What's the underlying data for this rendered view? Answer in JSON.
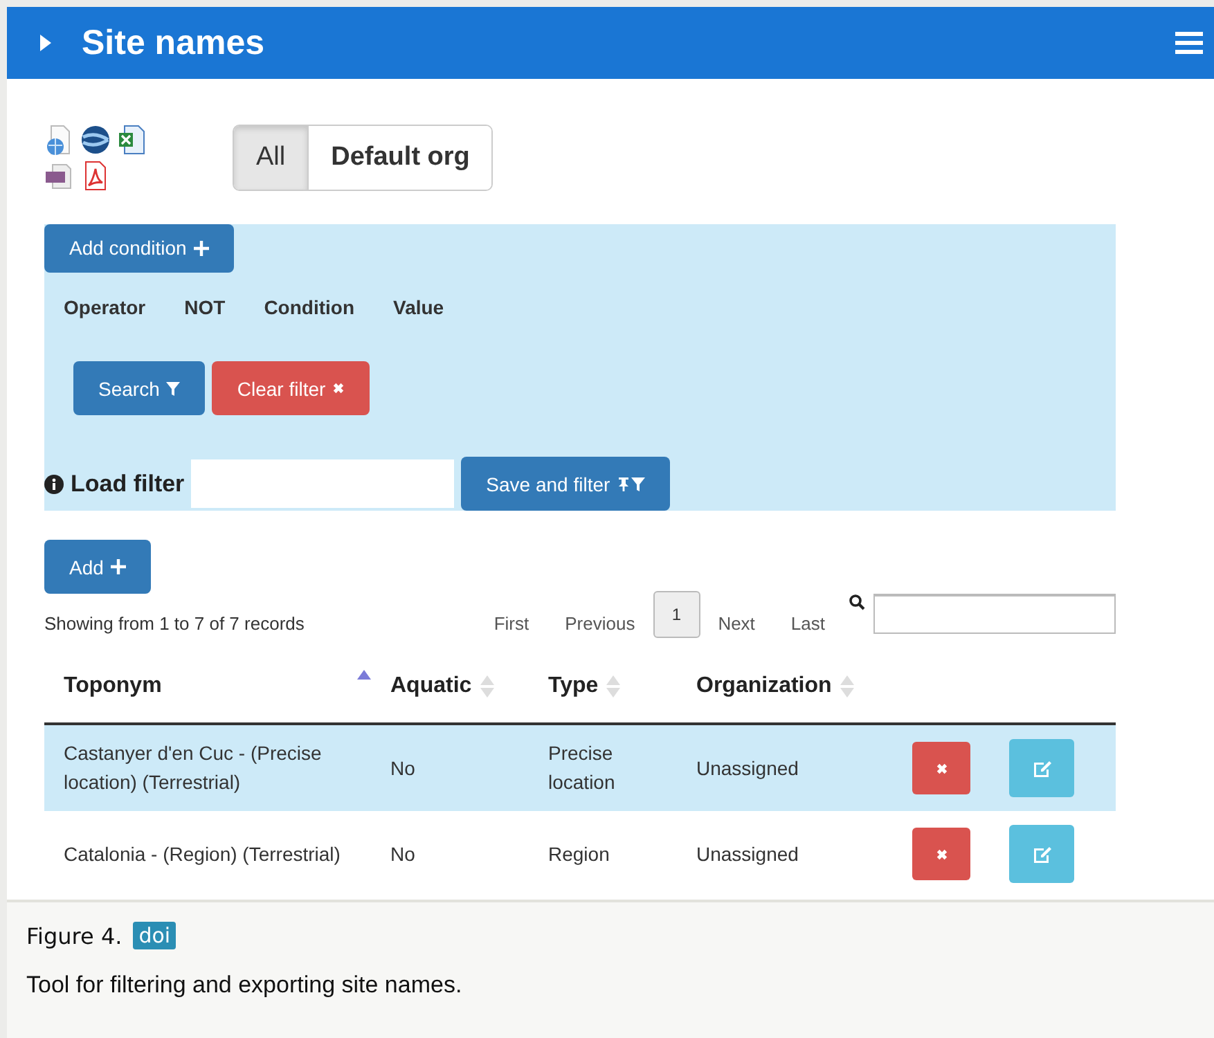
{
  "header": {
    "title": "Site names"
  },
  "exports": [
    {
      "kind": "web"
    },
    {
      "kind": "globe"
    },
    {
      "kind": "excel"
    },
    {
      "kind": "csv"
    },
    {
      "kind": "pdf"
    }
  ],
  "org_toggle": [
    {
      "label": "All",
      "selected": true
    },
    {
      "label": "Default org",
      "selected": false
    }
  ],
  "filter": {
    "add_condition": "Add condition",
    "columns": [
      "Operator",
      "NOT",
      "Condition",
      "Value"
    ],
    "search_button": "Search",
    "clear_button": "Clear filter",
    "load_filter_label": "Load filter",
    "save_button": "Save and filter"
  },
  "add_button": "Add",
  "records_info": "Showing from 1 to 7 of 7 records",
  "pagination": [
    {
      "label": "First",
      "kind": "link"
    },
    {
      "label": "Previous",
      "kind": "link"
    },
    {
      "label": "1",
      "kind": "page",
      "selected": true
    },
    {
      "label": "Next",
      "kind": "link"
    },
    {
      "label": "Last",
      "kind": "link"
    }
  ],
  "table": {
    "columns": [
      {
        "label": "Toponym",
        "sorted": true
      },
      {
        "label": "Aquatic",
        "sorted": false
      },
      {
        "label": "Type",
        "sorted": false
      },
      {
        "label": "Organization",
        "sorted": false
      }
    ],
    "rows": [
      {
        "cells": [
          "Castanyer d'en Cuc - (Precise location) (Terrestrial)",
          "No",
          "Precise location",
          "Unassigned"
        ],
        "selected": true
      },
      {
        "cells": [
          "Catalonia - (Region) (Terrestrial)",
          "No",
          "Region",
          "Unassigned"
        ],
        "selected": false
      }
    ]
  },
  "caption": {
    "figure_label": "Figure 4.",
    "doi": "doi",
    "text": "Tool for filtering and exporting site names."
  }
}
